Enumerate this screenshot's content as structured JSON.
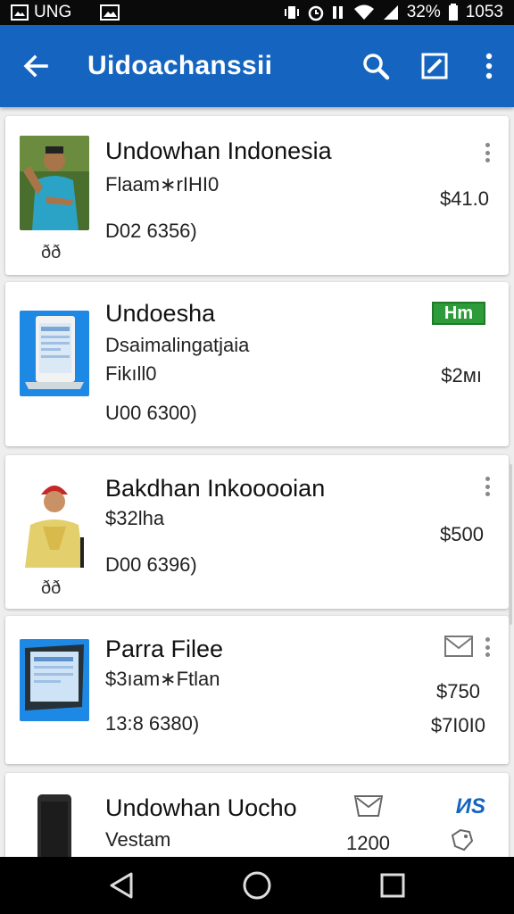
{
  "status": {
    "carrier": "UNG",
    "battery": "32%",
    "time": "1053"
  },
  "app_bar": {
    "title": "Uidoachanssii"
  },
  "items": [
    {
      "title": "Undowhan Indonesia",
      "line1": "Flaam∗rIHI0",
      "line2": "D02 6356)",
      "price": "$41.0",
      "caption": "ðð"
    },
    {
      "title": "Undoesha",
      "line1": "Dsaimalingatjaia",
      "line2": "Fikıll0",
      "line3": "U00 6300)",
      "price": "$2мı",
      "badge": "Hm"
    },
    {
      "title": "Bakdhan Inkooooian",
      "line1": "$32lha",
      "line2": "D00 6396)",
      "price": "$500",
      "caption": "ðð"
    },
    {
      "title": "Parra Filee",
      "line1": "$3ıam∗Ftlan",
      "line2": "13:8 6380)",
      "price": "$750",
      "price2": "$7I0I0"
    },
    {
      "title": "Undowhan Uocho",
      "line1": "Vestam",
      "mid_value": "1200",
      "badge": "ИS"
    }
  ],
  "colors": {
    "app_bar": "#1565c0",
    "status_bar": "#0a0a0a",
    "badge_green": "#2e9b3a",
    "badge_blue": "#1565c0"
  },
  "icons": {
    "back": "arrow-left-icon",
    "search": "search-icon",
    "edit": "edit-icon",
    "more": "more-vert-icon"
  }
}
